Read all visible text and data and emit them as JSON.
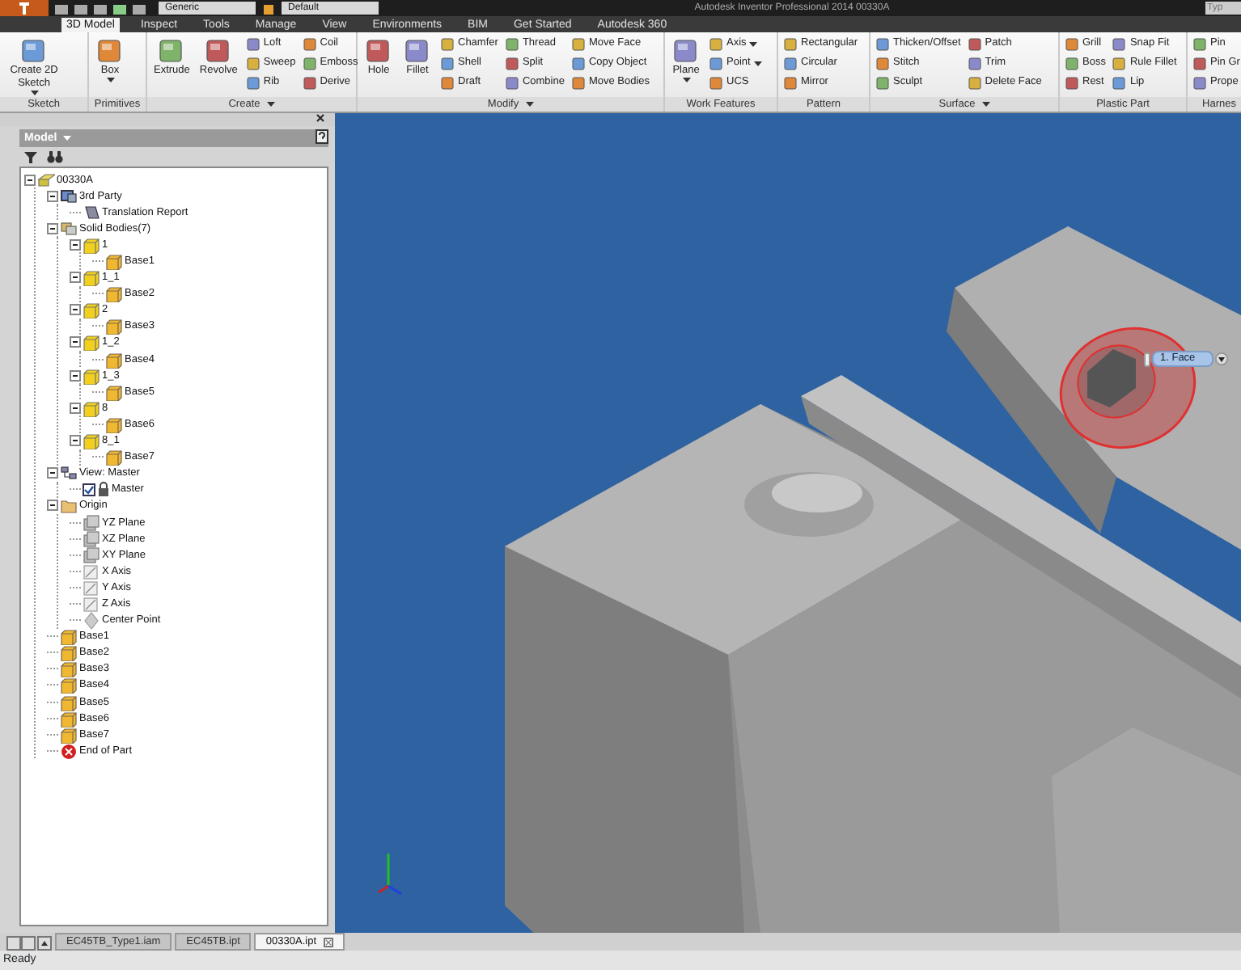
{
  "title_bar": {
    "material": "Generic",
    "appearance": "Default",
    "title": "Autodesk Inventor Professional 2014    00330A",
    "search_placeholder": "Typ"
  },
  "ribbon_tabs": [
    {
      "label": "3D Model",
      "selected": true
    },
    {
      "label": "Inspect",
      "selected": false
    },
    {
      "label": "Tools",
      "selected": false
    },
    {
      "label": "Manage",
      "selected": false
    },
    {
      "label": "View",
      "selected": false
    },
    {
      "label": "Environments",
      "selected": false
    },
    {
      "label": "BIM",
      "selected": false
    },
    {
      "label": "Get Started",
      "selected": false
    },
    {
      "label": "Autodesk 360",
      "selected": false
    }
  ],
  "ribbon_panels": [
    {
      "label": "Sketch",
      "menu": false,
      "tools": [
        {
          "kind": "large",
          "label": "Create 2D Sketch",
          "menu": true
        }
      ]
    },
    {
      "label": "Primitives",
      "menu": false,
      "tools": [
        {
          "kind": "large",
          "label": "Box",
          "menu": true
        }
      ]
    },
    {
      "label": "Create",
      "menu": true,
      "tools": [
        {
          "kind": "large",
          "label": "Extrude"
        },
        {
          "kind": "large",
          "label": "Revolve"
        },
        {
          "kind": "small",
          "label": "Loft"
        },
        {
          "kind": "small",
          "label": "Sweep"
        },
        {
          "kind": "small",
          "label": "Rib"
        },
        {
          "kind": "small",
          "label": "Coil"
        },
        {
          "kind": "small",
          "label": "Emboss"
        },
        {
          "kind": "small",
          "label": "Derive"
        }
      ]
    },
    {
      "label": "Modify",
      "menu": true,
      "tools": [
        {
          "kind": "large",
          "label": "Hole"
        },
        {
          "kind": "large",
          "label": "Fillet"
        },
        {
          "kind": "small",
          "label": "Chamfer"
        },
        {
          "kind": "small",
          "label": "Shell"
        },
        {
          "kind": "small",
          "label": "Draft"
        },
        {
          "kind": "small",
          "label": "Thread"
        },
        {
          "kind": "small",
          "label": "Split"
        },
        {
          "kind": "small",
          "label": "Combine"
        },
        {
          "kind": "small",
          "label": "Move Face"
        },
        {
          "kind": "small",
          "label": "Copy Object"
        },
        {
          "kind": "small",
          "label": "Move Bodies"
        }
      ]
    },
    {
      "label": "Work Features",
      "menu": false,
      "tools": [
        {
          "kind": "large",
          "label": "Plane",
          "menu": true
        },
        {
          "kind": "small",
          "label": "Axis",
          "menu": true
        },
        {
          "kind": "small",
          "label": "Point",
          "menu": true
        },
        {
          "kind": "small",
          "label": "UCS"
        }
      ]
    },
    {
      "label": "Pattern",
      "menu": false,
      "tools": [
        {
          "kind": "small",
          "label": "Rectangular"
        },
        {
          "kind": "small",
          "label": "Circular"
        },
        {
          "kind": "small",
          "label": "Mirror"
        }
      ]
    },
    {
      "label": "Surface",
      "menu": true,
      "tools": [
        {
          "kind": "small",
          "label": "Thicken/Offset"
        },
        {
          "kind": "small",
          "label": "Stitch"
        },
        {
          "kind": "small",
          "label": "Sculpt"
        },
        {
          "kind": "small",
          "label": "Patch"
        },
        {
          "kind": "small",
          "label": "Trim"
        },
        {
          "kind": "small",
          "label": "Delete Face"
        }
      ]
    },
    {
      "label": "Plastic Part",
      "menu": false,
      "tools": [
        {
          "kind": "small",
          "label": "Grill"
        },
        {
          "kind": "small",
          "label": "Boss"
        },
        {
          "kind": "small",
          "label": "Rest"
        },
        {
          "kind": "small",
          "label": "Snap Fit"
        },
        {
          "kind": "small",
          "label": "Rule Fillet"
        },
        {
          "kind": "small",
          "label": "Lip"
        }
      ]
    },
    {
      "label": "Harnes",
      "menu": false,
      "tools": [
        {
          "kind": "small",
          "label": "Pin"
        },
        {
          "kind": "small",
          "label": "Pin Gr"
        },
        {
          "kind": "small",
          "label": "Prope"
        }
      ]
    }
  ],
  "browser": {
    "title": "Model",
    "tree": [
      {
        "kind": "part",
        "label": "00330A",
        "expanded": true,
        "children": [
          {
            "kind": "thirdparty",
            "label": "3rd Party",
            "expanded": true,
            "children": [
              {
                "kind": "report",
                "label": "Translation Report"
              }
            ]
          },
          {
            "kind": "bodies",
            "label": "Solid Bodies(7)",
            "expanded": true,
            "children": [
              {
                "kind": "body",
                "label": "1",
                "expanded": true,
                "children": [
                  {
                    "kind": "feature",
                    "label": "Base1"
                  }
                ]
              },
              {
                "kind": "body",
                "label": "1_1",
                "expanded": true,
                "children": [
                  {
                    "kind": "feature",
                    "label": "Base2"
                  }
                ]
              },
              {
                "kind": "body",
                "label": "2",
                "expanded": true,
                "children": [
                  {
                    "kind": "feature",
                    "label": "Base3"
                  }
                ]
              },
              {
                "kind": "body",
                "label": "1_2",
                "expanded": true,
                "children": [
                  {
                    "kind": "feature",
                    "label": "Base4"
                  }
                ]
              },
              {
                "kind": "body",
                "label": "1_3",
                "expanded": true,
                "children": [
                  {
                    "kind": "feature",
                    "label": "Base5"
                  }
                ]
              },
              {
                "kind": "body",
                "label": "8",
                "expanded": true,
                "children": [
                  {
                    "kind": "feature",
                    "label": "Base6"
                  }
                ]
              },
              {
                "kind": "body",
                "label": "8_1",
                "expanded": true,
                "children": [
                  {
                    "kind": "feature",
                    "label": "Base7"
                  }
                ]
              }
            ]
          },
          {
            "kind": "view",
            "label": "View: Master",
            "expanded": true,
            "children": [
              {
                "kind": "rep",
                "label": "Master",
                "checked": true
              }
            ]
          },
          {
            "kind": "folder",
            "label": "Origin",
            "expanded": true,
            "children": [
              {
                "kind": "plane",
                "label": "YZ Plane"
              },
              {
                "kind": "plane",
                "label": "XZ Plane"
              },
              {
                "kind": "plane",
                "label": "XY Plane"
              },
              {
                "kind": "axis",
                "label": "X Axis"
              },
              {
                "kind": "axis",
                "label": "Y Axis"
              },
              {
                "kind": "axis",
                "label": "Z Axis"
              },
              {
                "kind": "point",
                "label": "Center Point"
              }
            ]
          },
          {
            "kind": "feature",
            "label": "Base1"
          },
          {
            "kind": "feature",
            "label": "Base2"
          },
          {
            "kind": "feature",
            "label": "Base3"
          },
          {
            "kind": "feature",
            "label": "Base4"
          },
          {
            "kind": "feature",
            "label": "Base5"
          },
          {
            "kind": "feature",
            "label": "Base6"
          },
          {
            "kind": "feature",
            "label": "Base7"
          },
          {
            "kind": "end",
            "label": "End of Part"
          }
        ]
      }
    ]
  },
  "viewport": {
    "selection_tooltip": "1. Face"
  },
  "document_tabs": [
    {
      "label": "EC45TB_Type1.iam",
      "selected": false
    },
    {
      "label": "EC45TB.ipt",
      "selected": false
    },
    {
      "label": "00330A.ipt",
      "selected": true
    }
  ],
  "status_bar": {
    "text": "Ready"
  }
}
